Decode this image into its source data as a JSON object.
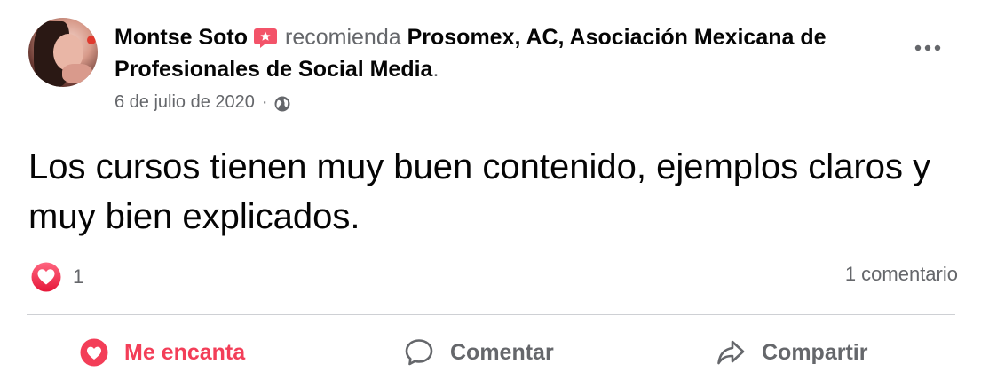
{
  "post": {
    "author": "Montse Soto",
    "action_text": "recomienda",
    "page_name": "Prosomex, AC, Asociación Mexicana de Profesionales de Social Media",
    "period": ".",
    "date": "6 de julio de 2020",
    "meta_separator": "·",
    "privacy_icon": "globe-icon",
    "body": "Los cursos tienen muy buen contenido, ejemplos claros y muy bien explicados."
  },
  "stats": {
    "reaction_icon": "love-reaction-icon",
    "reaction_count": "1",
    "comments": "1 comentario"
  },
  "actions": {
    "love_label": "Me encanta",
    "comment_label": "Comentar",
    "share_label": "Compartir"
  },
  "colors": {
    "love": "#f33e58",
    "recommend_badge": "#f35369",
    "secondary_text": "#65676b",
    "divider": "#ced0d4"
  }
}
